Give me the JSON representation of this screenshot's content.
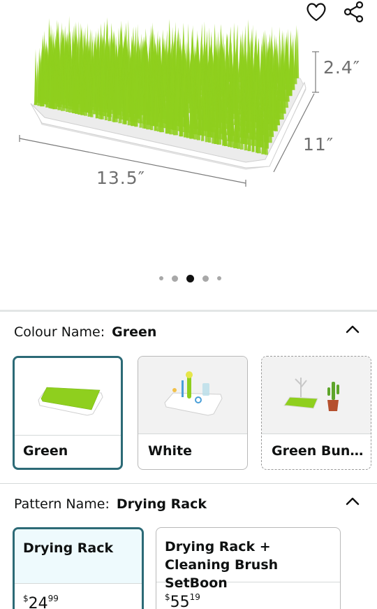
{
  "hero": {
    "dimensions": {
      "height": "2.4″",
      "depth": "11″",
      "width": "13.5″"
    },
    "carousel": {
      "dot_count": 5,
      "active_index": 2
    },
    "colors": {
      "grass": "#8fcf1e",
      "tray": "#f4f4f4"
    }
  },
  "colour": {
    "label": "Colour Name:",
    "value": "Green",
    "options": [
      {
        "name": "Green",
        "selected": true
      },
      {
        "name": "White",
        "selected": false
      },
      {
        "name": "Green Bun...",
        "selected": false
      }
    ]
  },
  "pattern": {
    "label": "Pattern Name:",
    "value": "Drying Rack",
    "options": [
      {
        "title": "Drying Rack",
        "price_symbol": "$",
        "price_whole": "24",
        "price_fraction": "99",
        "selected": true
      },
      {
        "title": "Drying Rack + Cleaning Brush SetBoon",
        "price_symbol": "$",
        "price_whole": "55",
        "price_fraction": "19",
        "selected": false
      }
    ]
  },
  "theme": {
    "accent": "#2c6a76",
    "selected_bg": "#eefafd"
  }
}
